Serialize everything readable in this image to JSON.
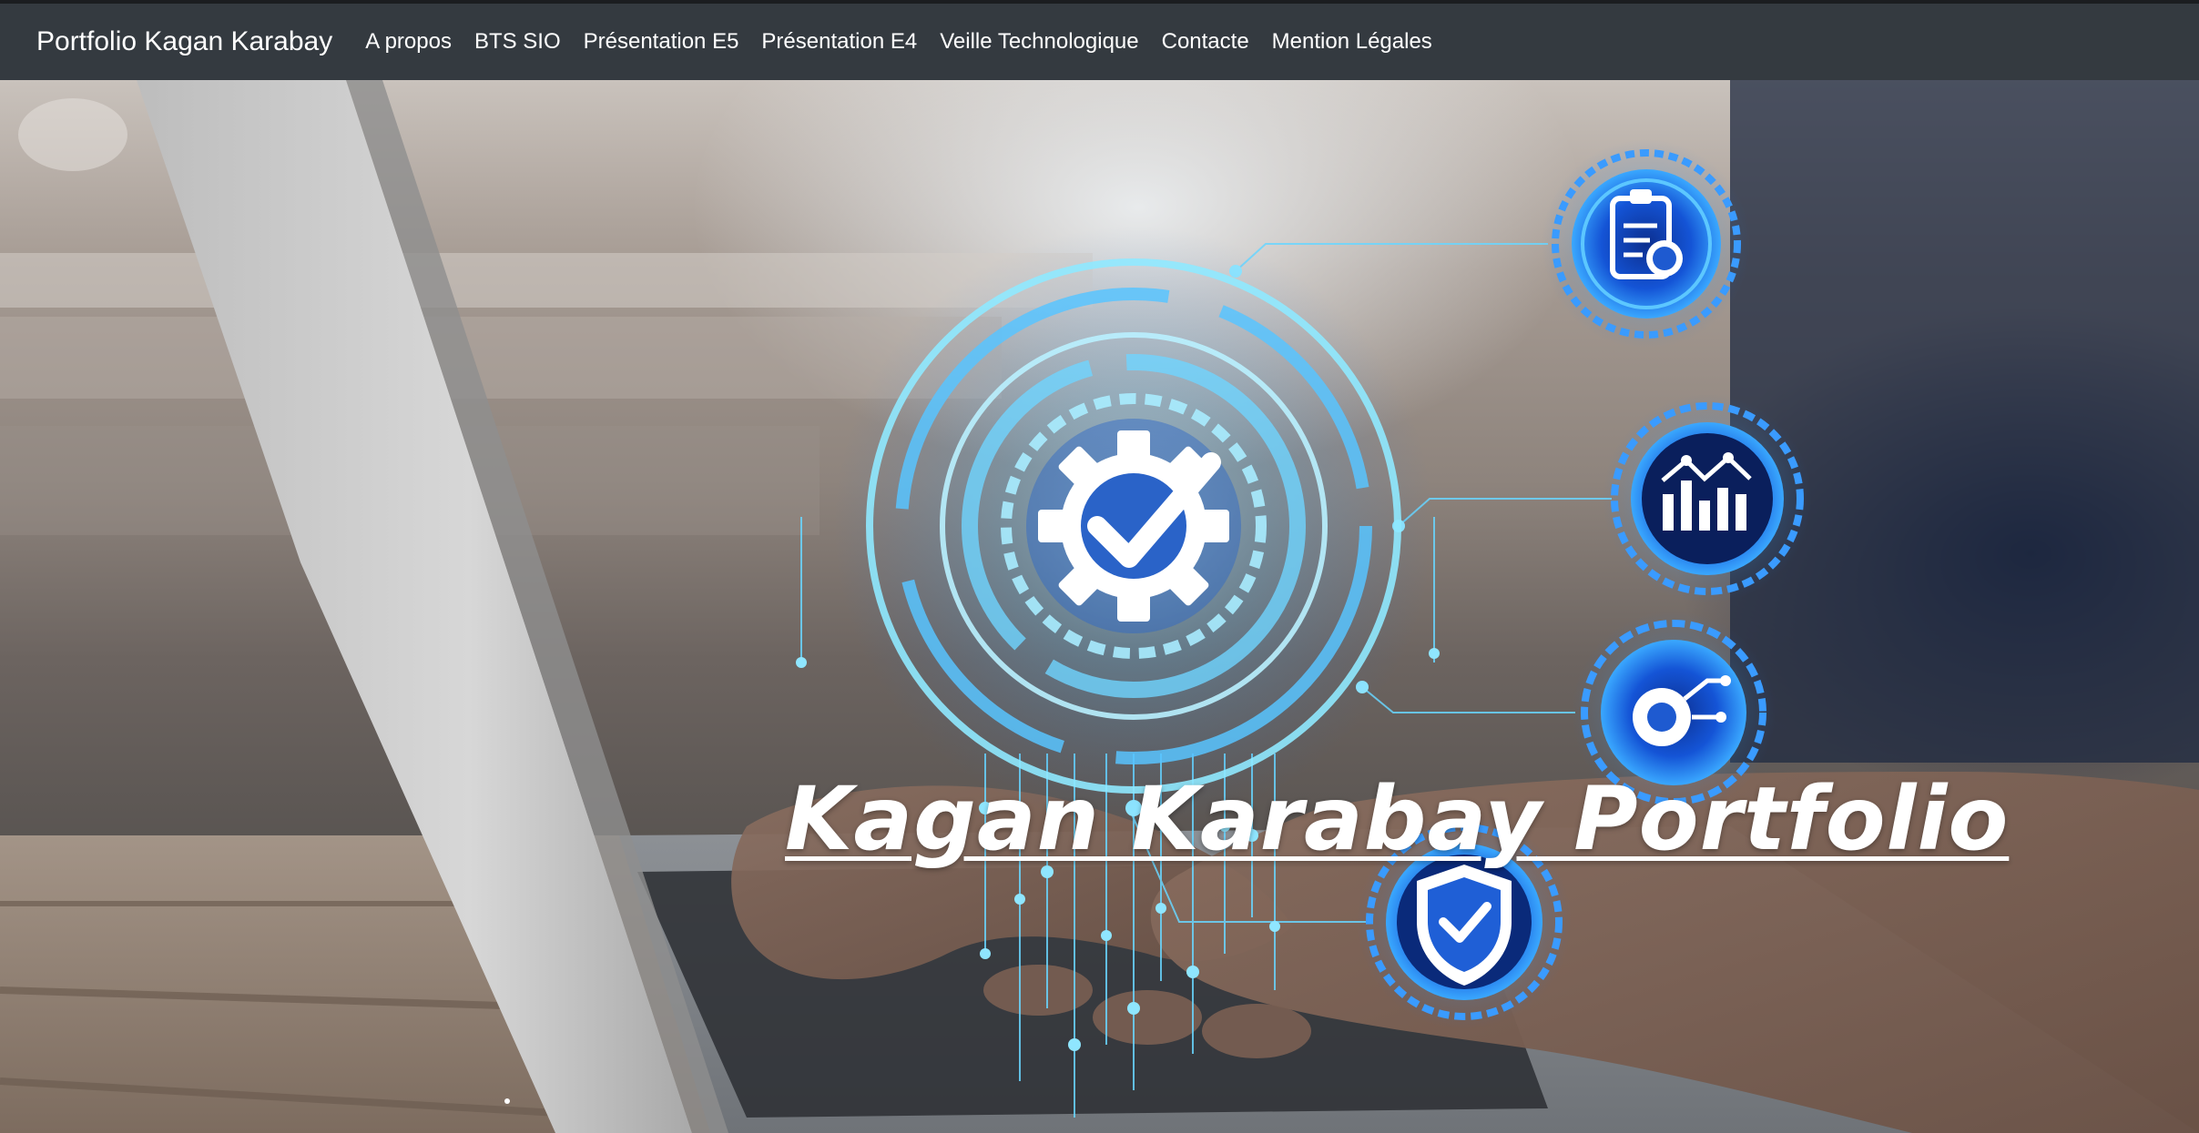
{
  "navbar": {
    "brand": "Portfolio Kagan Karabay",
    "links": [
      {
        "label": "A propos"
      },
      {
        "label": "BTS SIO"
      },
      {
        "label": "Présentation E5"
      },
      {
        "label": "Présentation E4"
      },
      {
        "label": "Veille Technologique"
      },
      {
        "label": "Contacte"
      },
      {
        "label": "Mention Légales"
      }
    ]
  },
  "hero": {
    "title": "Kagan Karabay Portfolio",
    "icons": [
      "gear-check-icon",
      "clipboard-badge-icon",
      "bar-chart-icon",
      "gear-circuit-icon",
      "shield-check-icon"
    ]
  },
  "colors": {
    "navbar_bg": "#343a40",
    "accent_blue": "#3aa8ff",
    "glow_cyan": "#7fe3ff"
  }
}
